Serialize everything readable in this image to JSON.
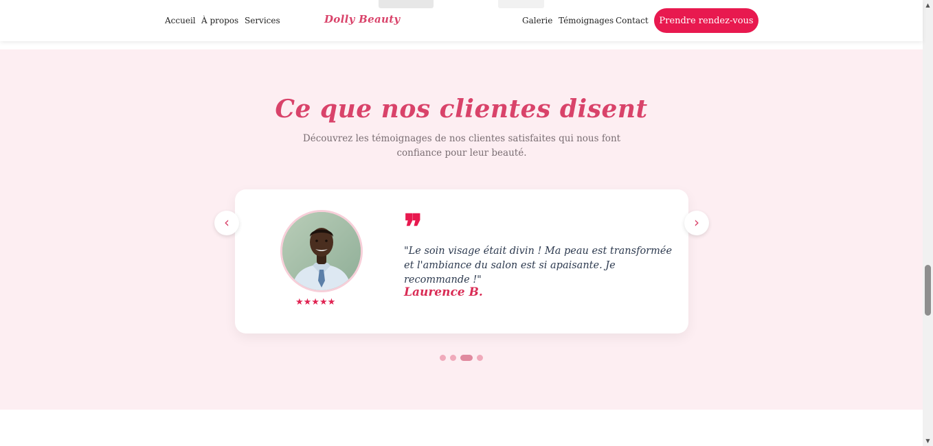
{
  "header": {
    "logo": "Dolly Beauty",
    "nav_left": [
      "Accueil",
      "À propos",
      "Services"
    ],
    "nav_right": [
      "Galerie",
      "Témoignages",
      "Contact"
    ],
    "cta_label": "Prendre rendez-vous"
  },
  "testimonials": {
    "title": "Ce que nos clientes disent",
    "subtitle": "Découvrez les témoignages de nos clientes satisfaites qui nous font confiance pour leur beauté.",
    "current": {
      "quote_icon": "❞",
      "quote": "\"Le soin visage était divin ! Ma peau est transformée et l'ambiance du salon est si apaisante. Je recommande !\"",
      "author": "Laurence B.",
      "rating": 5,
      "stars": "★★★★★"
    },
    "prev_icon": "‹",
    "next_icon": "›",
    "dots_count": 4,
    "active_dot": 3
  },
  "colors": {
    "accent": "#e8194f",
    "title": "#d9436a",
    "section_bg": "#fdeef2",
    "dot": "#f0aabb"
  },
  "icons": {
    "prev": "chevron-left-icon",
    "next": "chevron-right-icon",
    "quote": "quote-icon",
    "star": "star-icon"
  }
}
